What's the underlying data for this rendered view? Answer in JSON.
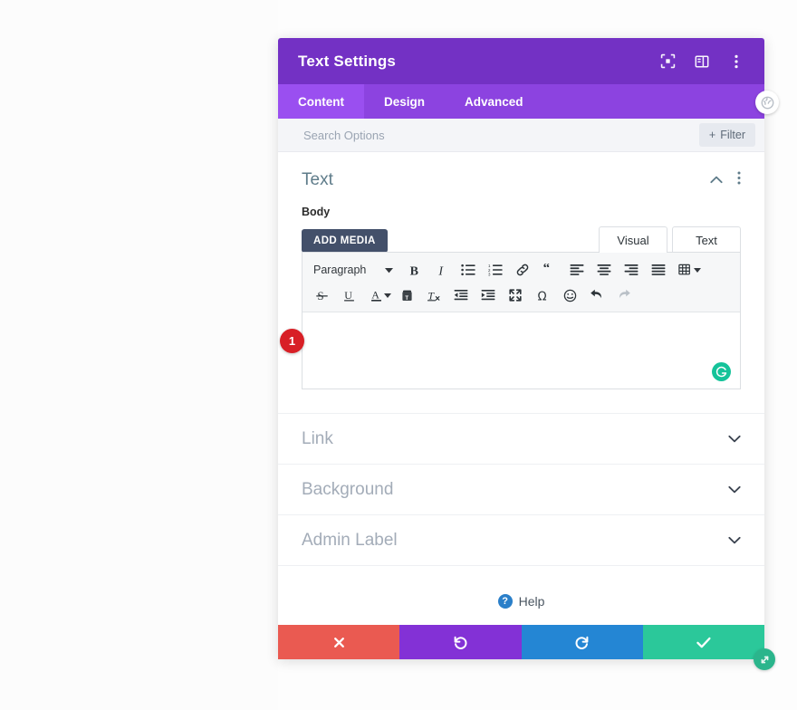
{
  "modal": {
    "title": "Text Settings",
    "header_icons": [
      {
        "name": "fullscreen-target-icon",
        "label": "Expand"
      },
      {
        "name": "layout-panel-icon",
        "label": "Panel layout"
      },
      {
        "name": "more-vertical-icon",
        "label": "More options"
      }
    ],
    "close_icon": "close-circle-icon",
    "tabs": [
      {
        "label": "Content",
        "active": true
      },
      {
        "label": "Design",
        "active": false
      },
      {
        "label": "Advanced",
        "active": false
      }
    ],
    "search": {
      "placeholder": "Search Options",
      "value": ""
    },
    "filter_button": {
      "label": "Filter",
      "plus": "+"
    }
  },
  "text_section": {
    "title": "Text",
    "collapse_icon": "chevron-up-icon",
    "menu_icon": "more-vertical-icon",
    "body_label": "Body",
    "add_media_label": "ADD MEDIA",
    "editor_tabs": [
      {
        "label": "Visual",
        "active": true
      },
      {
        "label": "Text",
        "active": false
      }
    ],
    "paragraph_select": {
      "value": "Paragraph"
    },
    "toolbar_row1": [
      {
        "name": "bold-icon",
        "title": "Bold"
      },
      {
        "name": "italic-icon",
        "title": "Italic"
      },
      {
        "name": "bulleted-list-icon",
        "title": "Bulleted list"
      },
      {
        "name": "numbered-list-icon",
        "title": "Numbered list"
      },
      {
        "name": "link-icon",
        "title": "Insert link"
      },
      {
        "name": "blockquote-icon",
        "title": "Blockquote"
      },
      {
        "name": "align-left-icon",
        "title": "Align left"
      },
      {
        "name": "align-center-icon",
        "title": "Align center"
      },
      {
        "name": "align-right-icon",
        "title": "Align right"
      },
      {
        "name": "align-justify-icon",
        "title": "Justify"
      },
      {
        "name": "table-icon",
        "title": "Table"
      }
    ],
    "toolbar_row2": [
      {
        "name": "strikethrough-icon",
        "title": "Strikethrough"
      },
      {
        "name": "underline-icon",
        "title": "Underline"
      },
      {
        "name": "text-color-icon",
        "title": "Text color"
      },
      {
        "name": "paste-as-text-icon",
        "title": "Paste as text"
      },
      {
        "name": "clear-formatting-icon",
        "title": "Clear formatting"
      },
      {
        "name": "outdent-icon",
        "title": "Decrease indent"
      },
      {
        "name": "indent-icon",
        "title": "Increase indent"
      },
      {
        "name": "fullscreen-icon",
        "title": "Fullscreen"
      },
      {
        "name": "special-character-icon",
        "title": "Special character"
      },
      {
        "name": "emoji-icon",
        "title": "Emoji"
      },
      {
        "name": "undo-icon",
        "title": "Undo"
      },
      {
        "name": "redo-icon",
        "title": "Redo"
      }
    ],
    "editor_value": "",
    "grammarly_icon": "grammarly-icon",
    "step_badge": "1"
  },
  "collapsed_sections": [
    {
      "title": "Link",
      "icon": "chevron-down-icon"
    },
    {
      "title": "Background",
      "icon": "chevron-down-icon"
    },
    {
      "title": "Admin Label",
      "icon": "chevron-down-icon"
    }
  ],
  "help": {
    "label": "Help",
    "icon_glyph": "?"
  },
  "footer_buttons": [
    {
      "name": "cancel-button",
      "icon": "close-icon",
      "color": "#ea5a51"
    },
    {
      "name": "undo-button",
      "icon": "undo-icon",
      "color": "#8331d6"
    },
    {
      "name": "redo-button",
      "icon": "redo-icon",
      "color": "#2486d4"
    },
    {
      "name": "save-button",
      "icon": "check-icon",
      "color": "#2bc89a"
    }
  ],
  "resize_handle": "resize-handle-icon",
  "colors": {
    "header_purple": "#7331c4",
    "tab_purple": "#8c43e0",
    "tab_active_purple": "#9a4ff0",
    "badge_red": "#d81f26",
    "grammarly_green": "#15c39a",
    "help_blue": "#2a7fc9"
  }
}
